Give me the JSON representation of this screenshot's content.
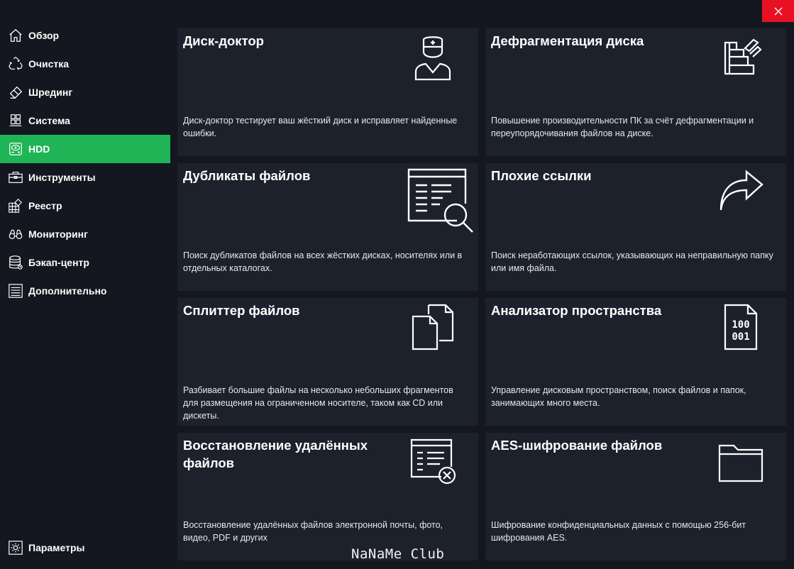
{
  "window": {
    "close_icon": "close-icon",
    "close_color": "#e81123"
  },
  "sidebar": {
    "active_color": "#1fb455",
    "items": [
      {
        "label": "Обзор",
        "icon": "home-icon"
      },
      {
        "label": "Очистка",
        "icon": "recycle-icon"
      },
      {
        "label": "Шрединг",
        "icon": "eraser-icon"
      },
      {
        "label": "Система",
        "icon": "windows-icon"
      },
      {
        "label": "HDD",
        "icon": "hdd-icon"
      },
      {
        "label": "Инструменты",
        "icon": "toolbox-icon"
      },
      {
        "label": "Реестр",
        "icon": "registry-icon"
      },
      {
        "label": "Мониторинг",
        "icon": "binoculars-icon"
      },
      {
        "label": "Бэкап-центр",
        "icon": "database-icon"
      },
      {
        "label": "Дополнительно",
        "icon": "list-icon"
      }
    ],
    "settings": {
      "label": "Параметры",
      "icon": "gear-icon"
    }
  },
  "tiles": [
    {
      "title": "Диск-доктор",
      "description": "Диск-доктор тестирует ваш жёсткий диск и исправляет найденные ошибки.",
      "icon": "doctor-icon"
    },
    {
      "title": "Дефрагментация диска",
      "description": "Повышение производительности ПК за счёт дефрагментации и переупорядочивания файлов на диске.",
      "icon": "defrag-icon"
    },
    {
      "title": "Дубликаты файлов",
      "description": "Поиск дубликатов файлов на всех жёстких дисках, носителях или в отдельных каталогах.",
      "icon": "document-search-icon"
    },
    {
      "title": "Плохие ссылки",
      "description": "Поиск неработающих ссылок, указывающих на неправильную папку или имя файла.",
      "icon": "arrow-redirect-icon"
    },
    {
      "title": "Сплиттер файлов",
      "description": "Разбивает большие файлы на несколько небольших фрагментов для размещения на ограниченном носителе, таком как CD или дискеты.",
      "icon": "split-files-icon"
    },
    {
      "title": "Анализатор пространства",
      "description": "Управление дисковым пространством, поиск файлов и папок, занимающих много места.",
      "icon": "binary-file-icon"
    },
    {
      "title": "Восстановление удалённых файлов",
      "description": "Восстановление удалённых файлов электронной почты, фото, видео, PDF и других",
      "icon": "document-delete-icon"
    },
    {
      "title": "AES-шифрование файлов",
      "description": "Шифрование конфиденциальных данных с помощью 256-бит шифрования AES.",
      "icon": "folder-icon"
    }
  ],
  "watermark": "NaNaMe Club"
}
